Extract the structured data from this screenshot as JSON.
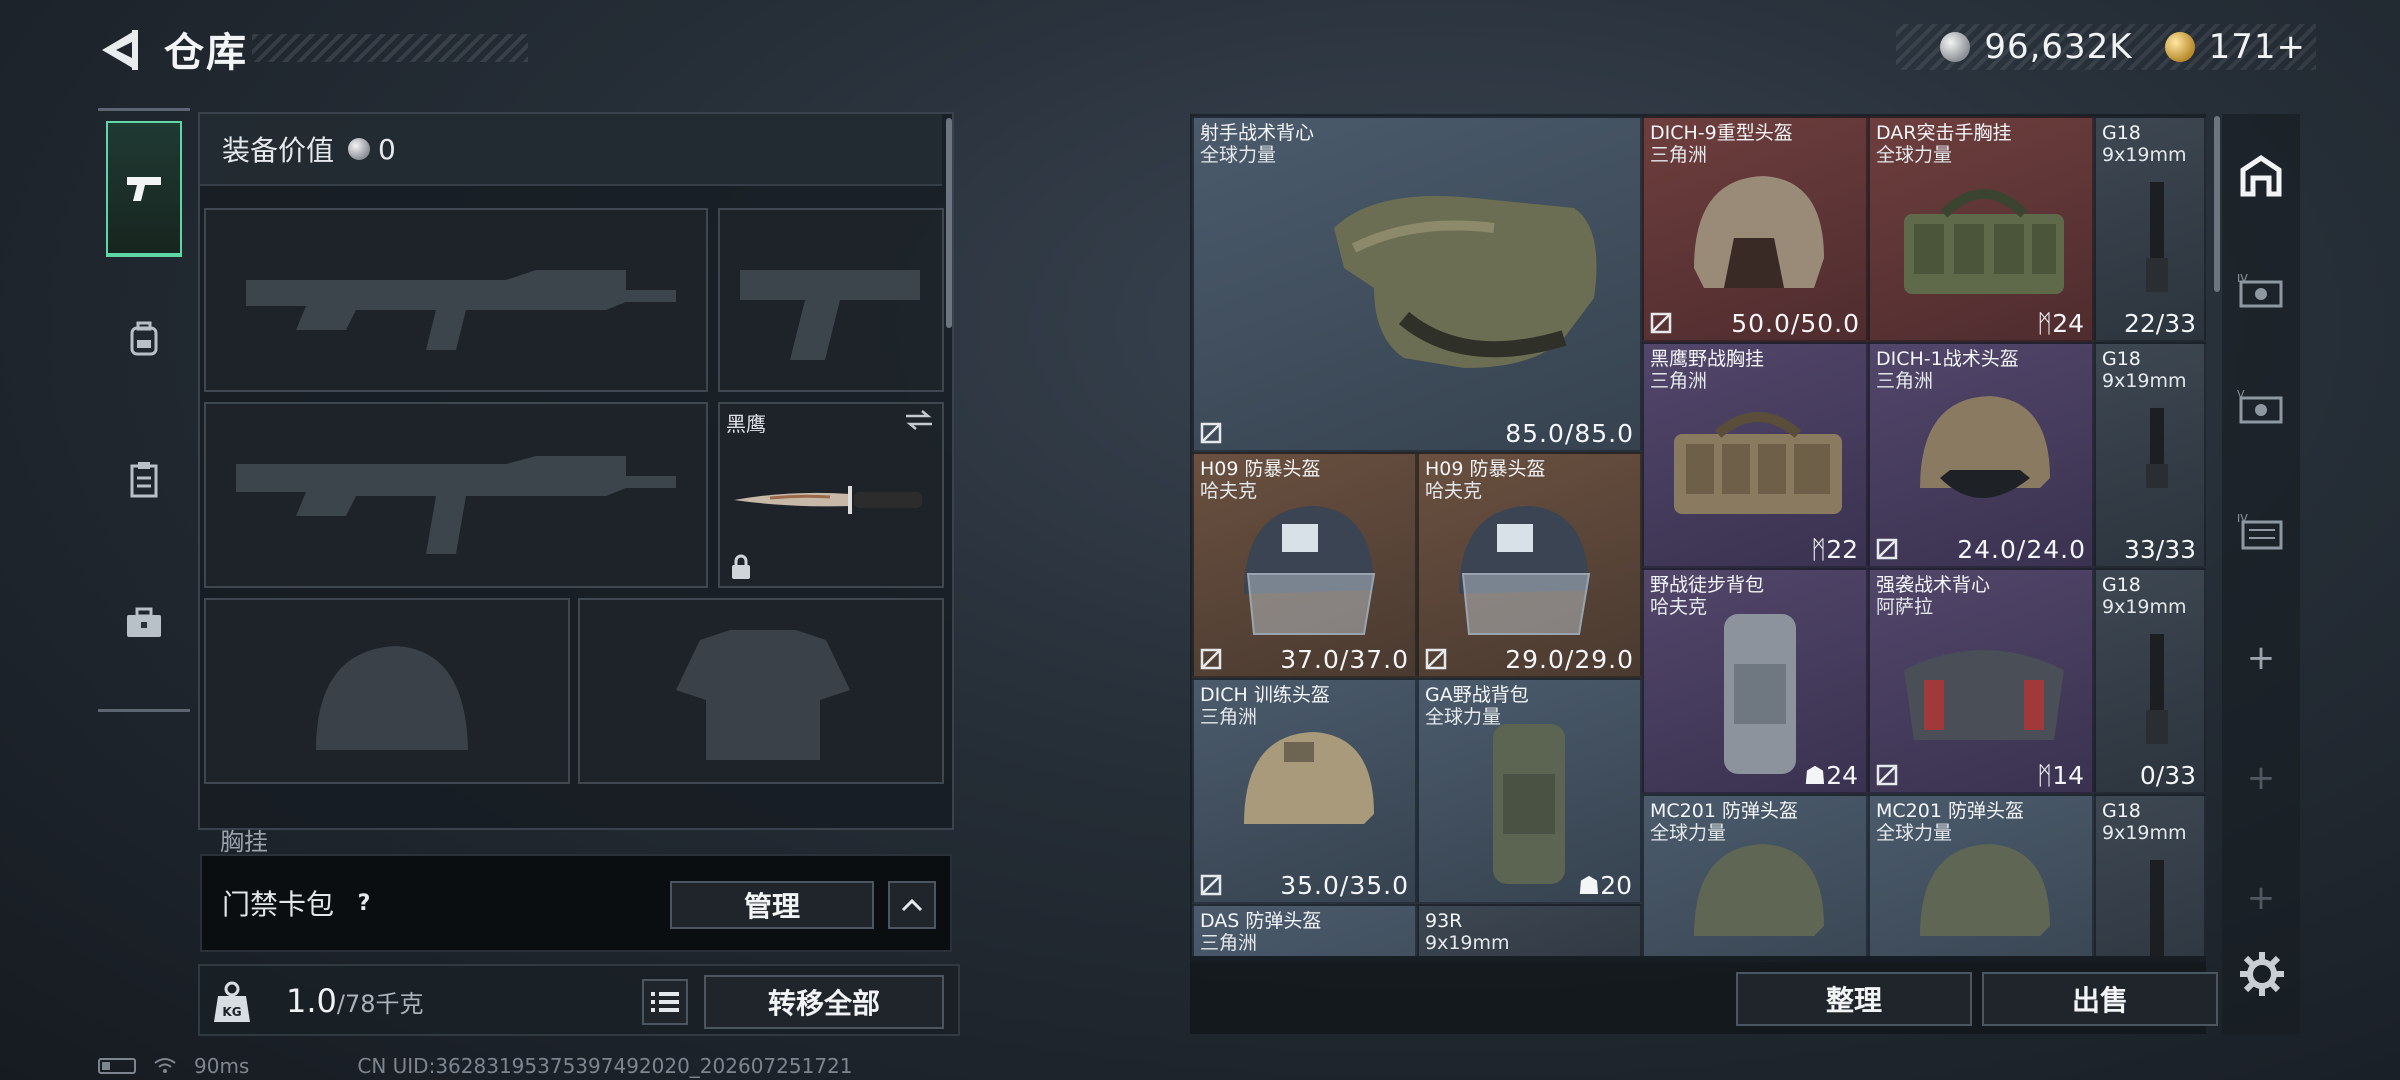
{
  "header": {
    "title": "仓库",
    "currencies": [
      {
        "icon": "silver-coin-icon",
        "value": "96,632K"
      },
      {
        "icon": "gold-coin-icon",
        "value": "171+"
      }
    ]
  },
  "left": {
    "categories": [
      {
        "name": "pistol-icon",
        "active": true
      },
      {
        "name": "backpack-icon",
        "active": false
      },
      {
        "name": "clipboard-icon",
        "active": false
      },
      {
        "name": "briefcase-icon",
        "active": false
      }
    ],
    "equip_value_label": "装备价值",
    "equip_value": "0",
    "knife_slot_name": "黑鹰",
    "chest_label": "胸挂",
    "card_pack_label": "门禁卡包",
    "help_mark": "?",
    "manage_label": "管理",
    "weight_current": "1.0",
    "weight_max": "/78千克",
    "transfer_all_label": "转移全部"
  },
  "status": {
    "ping": "90ms",
    "uid": "CN UID:3628319537539749​2020_202607251721"
  },
  "stash": {
    "items": [
      {
        "name": "射手战术背心",
        "sub": "全球力量",
        "value": "85.0/85.0",
        "value_type": "durability",
        "rarity": "blue",
        "icon": "tactical-vest-icon"
      },
      {
        "name": "DICH-9重型头盔",
        "sub": "三角洲",
        "value": "50.0/50.0",
        "value_type": "durability",
        "rarity": "red",
        "icon": "helmet-icon"
      },
      {
        "name": "DAR突击手胸挂",
        "sub": "全球力量",
        "value": "24",
        "value_type": "capacity",
        "rarity": "red",
        "icon": "chest-rig-icon"
      },
      {
        "name": "G18",
        "sub": "9x19mm",
        "value": "22/33",
        "value_type": "ammo",
        "rarity": "grey",
        "icon": "magazine-icon"
      },
      {
        "name": "黑鹰野战胸挂",
        "sub": "三角洲",
        "value": "22",
        "value_type": "capacity",
        "rarity": "purple",
        "icon": "chest-rig-icon"
      },
      {
        "name": "DICH-1战术头盔",
        "sub": "三角洲",
        "value": "24.0/24.0",
        "value_type": "durability",
        "rarity": "purple",
        "icon": "helmet-icon"
      },
      {
        "name": "G18",
        "sub": "9x19mm",
        "value": "33/33",
        "value_type": "ammo",
        "rarity": "grey",
        "icon": "magazine-icon"
      },
      {
        "name": "H09 防暴头盔",
        "sub": "哈夫克",
        "value": "37.0/37.0",
        "value_type": "durability",
        "rarity": "brown",
        "icon": "riot-helmet-icon"
      },
      {
        "name": "H09 防暴头盔",
        "sub": "哈夫克",
        "value": "29.0/29.0",
        "value_type": "durability",
        "rarity": "brown",
        "icon": "riot-helmet-icon"
      },
      {
        "name": "野战徒步背包",
        "sub": "哈夫克",
        "value": "24",
        "value_type": "capacity",
        "rarity": "purple",
        "icon": "backpack-icon"
      },
      {
        "name": "强袭战术背心",
        "sub": "阿萨拉",
        "value": "14",
        "value_type": "capacity",
        "rarity": "purple",
        "icon": "tactical-vest-icon"
      },
      {
        "name": "G18",
        "sub": "9x19mm",
        "value": "0/33",
        "value_type": "ammo",
        "rarity": "grey",
        "icon": "magazine-icon"
      },
      {
        "name": "DICH 训练头盔",
        "sub": "三角洲",
        "value": "35.0/35.0",
        "value_type": "durability",
        "rarity": "blue",
        "icon": "helmet-icon"
      },
      {
        "name": "GA野战背包",
        "sub": "全球力量",
        "value": "20",
        "value_type": "capacity",
        "rarity": "blue",
        "icon": "backpack-icon"
      },
      {
        "name": "MC201 防弹头盔",
        "sub": "全球力量",
        "value": "",
        "value_type": "durability",
        "rarity": "blue",
        "icon": "helmet-icon"
      },
      {
        "name": "MC201 防弹头盔",
        "sub": "全球力量",
        "value": "",
        "value_type": "durability",
        "rarity": "blue",
        "icon": "helmet-icon"
      },
      {
        "name": "G18",
        "sub": "9x19mm",
        "value": "",
        "value_type": "ammo",
        "rarity": "grey",
        "icon": "magazine-icon"
      },
      {
        "name": "DAS 防弹头盔",
        "sub": "三角洲",
        "value": "",
        "value_type": "durability",
        "rarity": "blue",
        "icon": "helmet-icon"
      },
      {
        "name": "93R",
        "sub": "9x19mm",
        "value": "",
        "value_type": "ammo",
        "rarity": "grey",
        "icon": "magazine-icon"
      }
    ],
    "sort_label": "整理",
    "sell_label": "出售"
  },
  "rail": [
    {
      "name": "stash-home-icon"
    },
    {
      "name": "storage-tab-4-icon",
      "text": "IV"
    },
    {
      "name": "storage-tab-5-icon",
      "text": "V"
    },
    {
      "name": "storage-tab-4b-icon",
      "text": "IV"
    },
    {
      "name": "add-storage-icon",
      "text": "+"
    },
    {
      "name": "add-storage-icon",
      "text": "+"
    },
    {
      "name": "add-storage-icon",
      "text": "+"
    }
  ]
}
